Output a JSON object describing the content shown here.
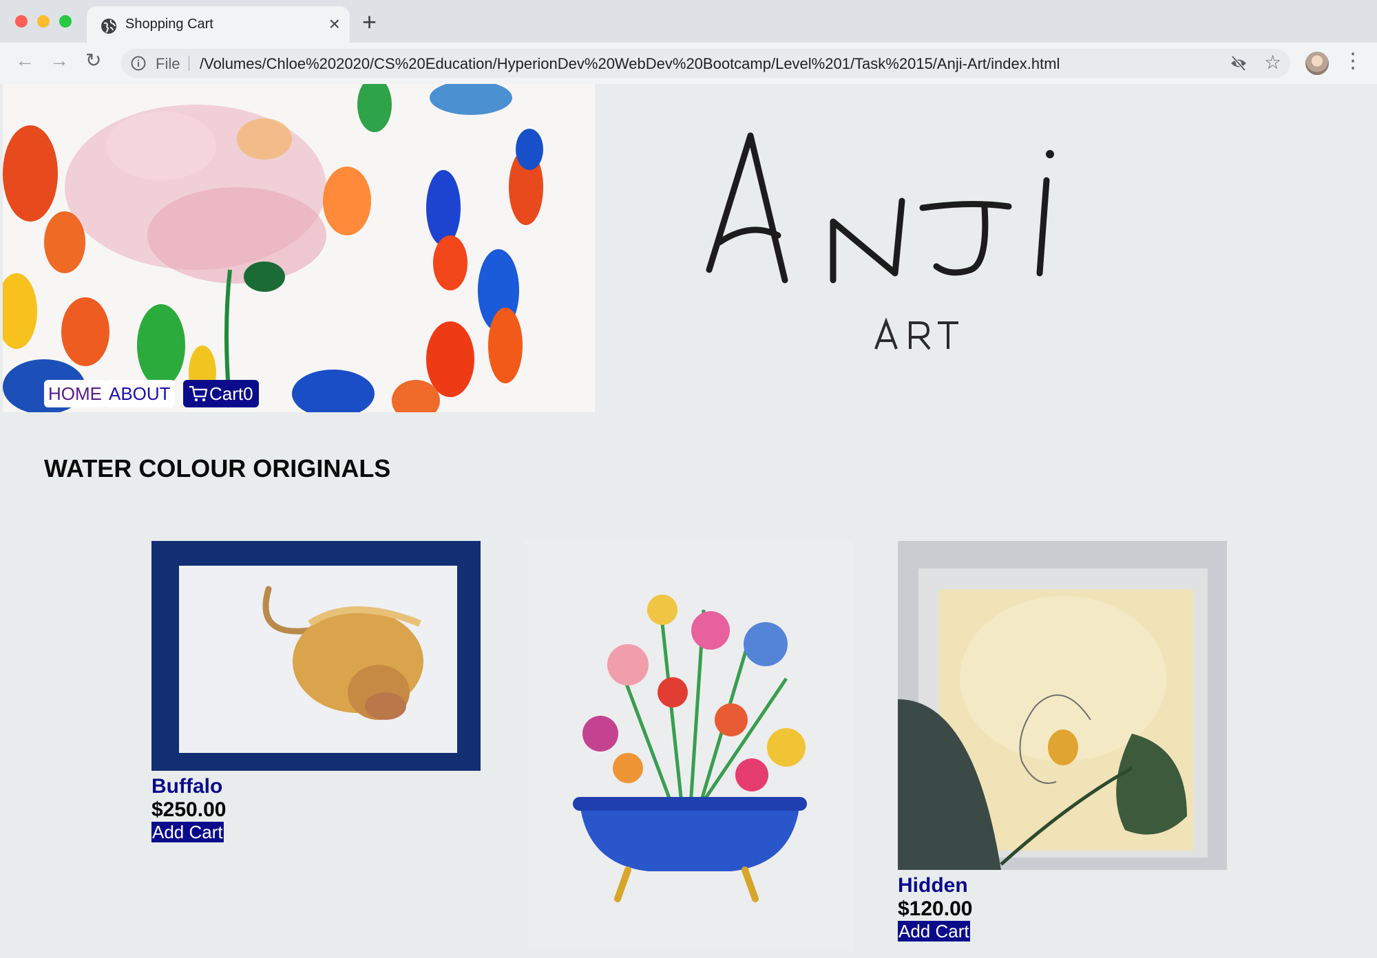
{
  "browser": {
    "tab_title": "Shopping Cart",
    "file_label": "File",
    "url": "/Volumes/Chloe%202020/CS%20Education/HyperionDev%20WebDev%20Bootcamp/Level%201/Task%2015/Anji-Art/index.html"
  },
  "site": {
    "logo_main": "Anji",
    "logo_sub": "ART",
    "colors": {
      "accent": "#0b0b8c",
      "page_bg": "#e9ecec"
    }
  },
  "nav": {
    "home": "HOME",
    "about": "ABOUT",
    "cart_label": "Cart",
    "cart_count": "0"
  },
  "section": {
    "title": "WATER COLOUR ORIGINALS"
  },
  "products": [
    {
      "name": "Buffalo",
      "price": "$250.00",
      "button": "Add Cart"
    },
    {
      "name": "",
      "price": "",
      "button": ""
    },
    {
      "name": "Hidden",
      "price": "$120.00",
      "button": "Add Cart"
    }
  ]
}
